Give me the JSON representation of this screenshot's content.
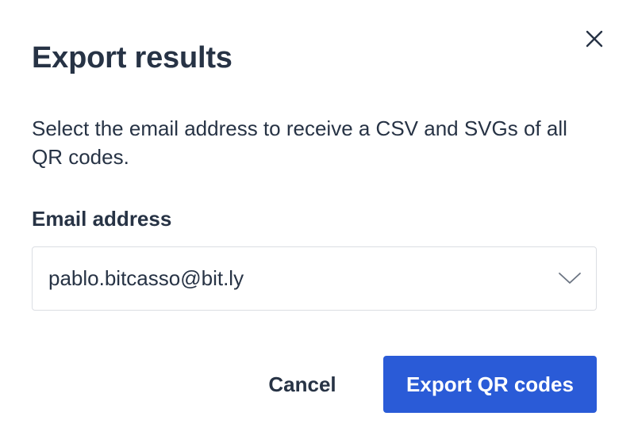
{
  "dialog": {
    "title": "Export results",
    "description": "Select the email address to receive a CSV and SVGs of all QR codes.",
    "close_icon": "close-icon"
  },
  "email_field": {
    "label": "Email address",
    "selected_value": "pablo.bitcasso@bit.ly",
    "dropdown_icon": "chevron-down-icon"
  },
  "actions": {
    "cancel_label": "Cancel",
    "export_label": "Export QR codes"
  },
  "colors": {
    "primary": "#2a5bd7",
    "text": "#273345",
    "border": "#dbdee3",
    "background": "#ffffff"
  }
}
